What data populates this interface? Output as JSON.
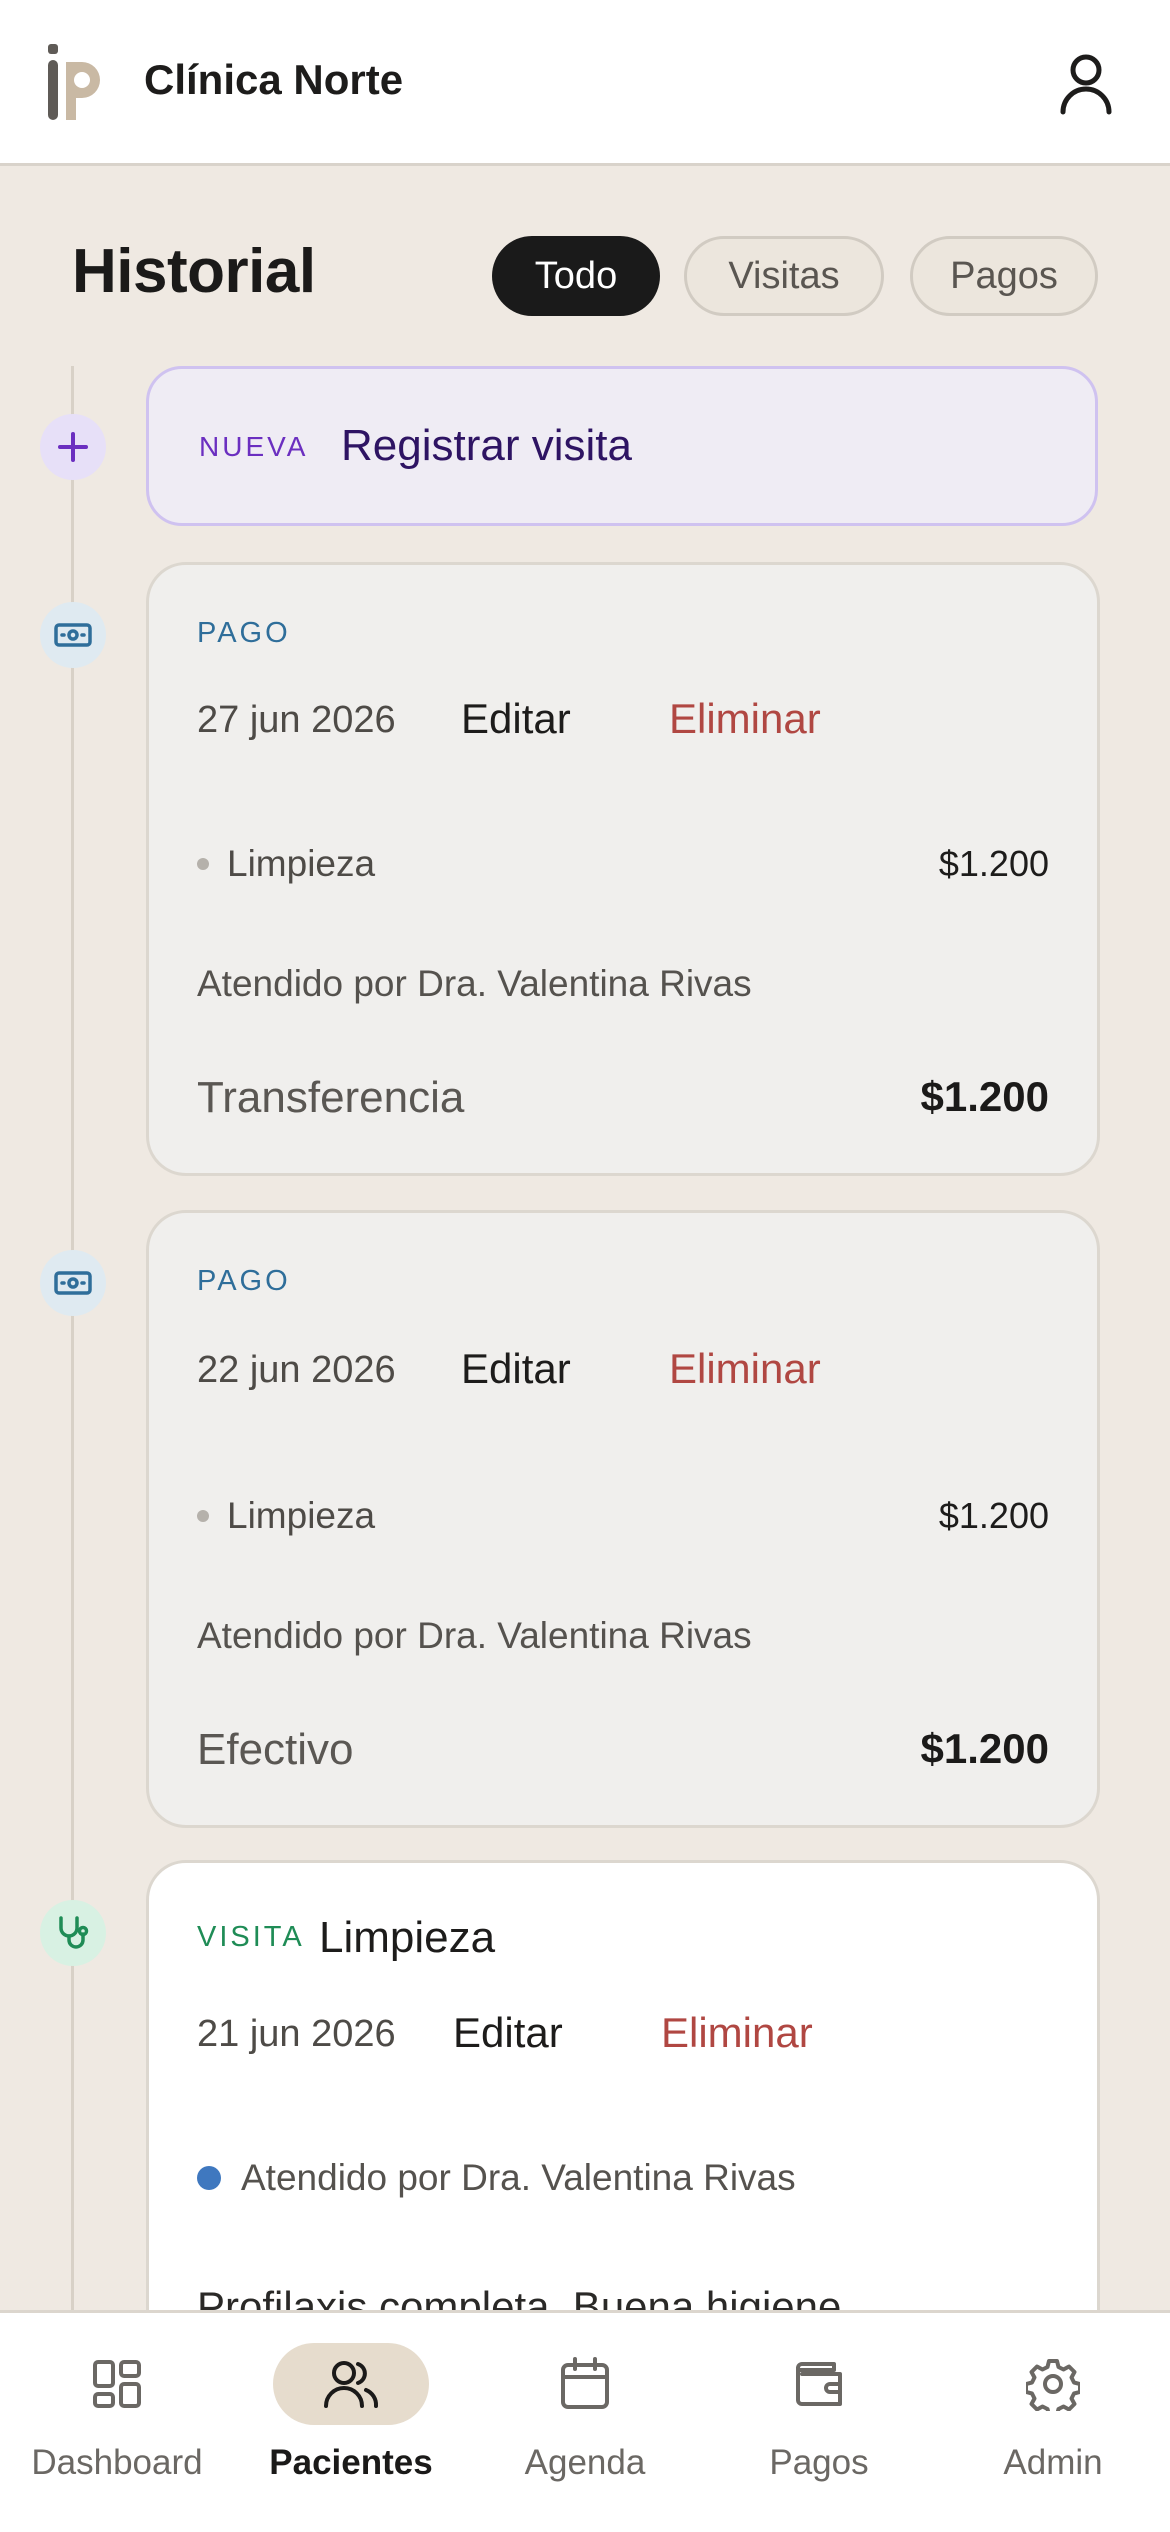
{
  "header": {
    "clinic_name": "Clínica Norte",
    "logo_icon": "ip-logo",
    "profile_icon": "user-icon"
  },
  "page": {
    "title": "Historial",
    "filters": [
      {
        "label": "Todo",
        "active": true
      },
      {
        "label": "Visitas",
        "active": false
      },
      {
        "label": "Pagos",
        "active": false
      }
    ]
  },
  "new_entry": {
    "tag": "NUEVA",
    "label": "Registrar visita"
  },
  "entries": [
    {
      "type": "pago",
      "tag": "PAGO",
      "date": "27 jun 2026",
      "edit_label": "Editar",
      "delete_label": "Eliminar",
      "service": "Limpieza",
      "service_amount": "$1.200",
      "attended_by": "Atendido por Dra. Valentina Rivas",
      "method": "Transferencia",
      "total": "$1.200"
    },
    {
      "type": "pago",
      "tag": "PAGO",
      "date": "22 jun 2026",
      "edit_label": "Editar",
      "delete_label": "Eliminar",
      "service": "Limpieza",
      "service_amount": "$1.200",
      "attended_by": "Atendido por Dra. Valentina Rivas",
      "method": "Efectivo",
      "total": "$1.200"
    },
    {
      "type": "visita",
      "tag": "VISITA",
      "title": "Limpieza",
      "date": "21 jun 2026",
      "edit_label": "Editar",
      "delete_label": "Eliminar",
      "attended_by": "Atendido por Dra. Valentina Rivas",
      "notes": "Profilaxis completa. Buena higiene"
    }
  ],
  "bottom_nav": [
    {
      "label": "Dashboard",
      "icon": "dashboard-icon",
      "active": false
    },
    {
      "label": "Pacientes",
      "icon": "users-icon",
      "active": true
    },
    {
      "label": "Agenda",
      "icon": "calendar-icon",
      "active": false
    },
    {
      "label": "Pagos",
      "icon": "wallet-icon",
      "active": false
    },
    {
      "label": "Admin",
      "icon": "gear-icon",
      "active": false
    }
  ],
  "colors": {
    "background": "#efe9e2",
    "accent_purple": "#6b2fc0",
    "pago_blue": "#2f6e9a",
    "visita_green": "#1f8c56",
    "delete_red": "#b04742"
  }
}
